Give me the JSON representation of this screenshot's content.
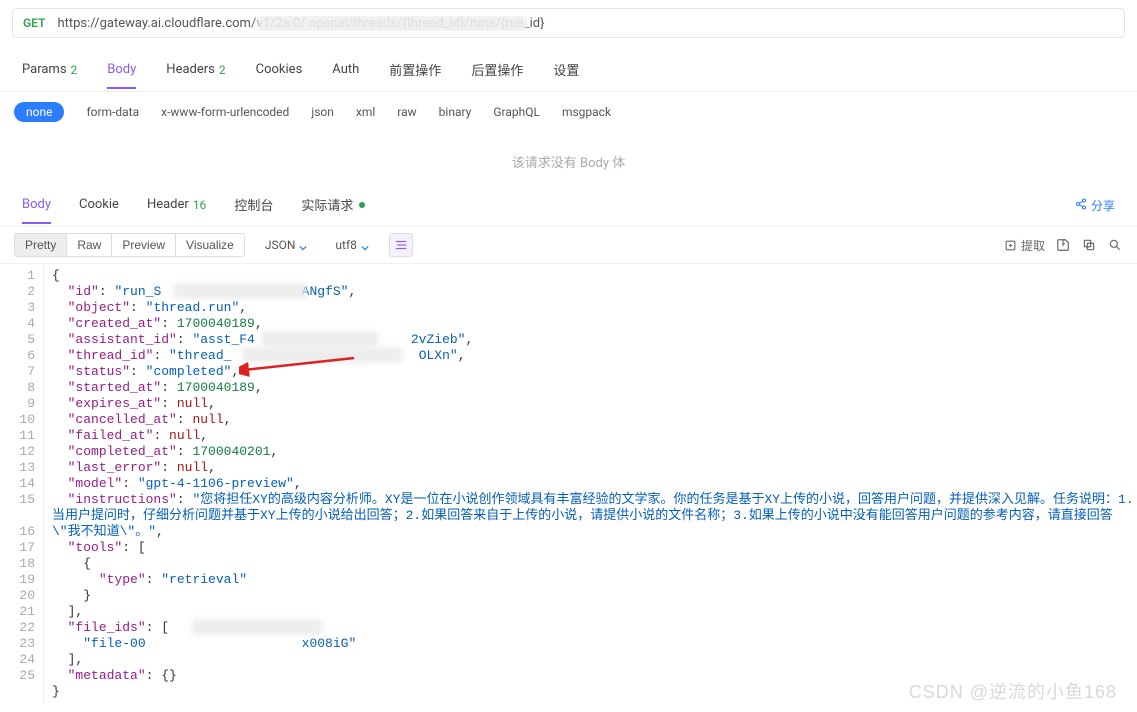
{
  "request": {
    "method": "GET",
    "url": "https://gateway.ai.cloudflare.com/v1/2a                                            0/          openai/threads/{thread_id}/runs/{run_id}"
  },
  "req_tabs": [
    {
      "label": "Params",
      "badge": "2",
      "active": false
    },
    {
      "label": "Body",
      "badge": "",
      "active": true
    },
    {
      "label": "Headers",
      "badge": "2",
      "active": false
    },
    {
      "label": "Cookies",
      "badge": "",
      "active": false
    },
    {
      "label": "Auth",
      "badge": "",
      "active": false
    },
    {
      "label": "前置操作",
      "badge": "",
      "active": false
    },
    {
      "label": "后置操作",
      "badge": "",
      "active": false
    },
    {
      "label": "设置",
      "badge": "",
      "active": false
    }
  ],
  "body_types": {
    "selected": "none",
    "options": [
      "form-data",
      "x-www-form-urlencoded",
      "json",
      "xml",
      "raw",
      "binary",
      "GraphQL",
      "msgpack"
    ]
  },
  "empty_body_text": "该请求没有 Body 体",
  "response_tabs": [
    {
      "label": "Body",
      "badge": "",
      "active": true
    },
    {
      "label": "Cookie",
      "badge": "",
      "active": false
    },
    {
      "label": "Header",
      "badge": "16",
      "active": false
    },
    {
      "label": "控制台",
      "badge": "",
      "active": false
    },
    {
      "label": "实际请求",
      "badge": "",
      "active": false,
      "dot": true
    }
  ],
  "share_label": "分享",
  "view_modes": {
    "options": [
      "Pretty",
      "Raw",
      "Preview",
      "Visualize"
    ],
    "active": "Pretty"
  },
  "format_dropdown": "JSON",
  "encoding_dropdown": "utf8",
  "extract_label": "提取",
  "code_lines": [
    {
      "n": 1,
      "indent": 0,
      "tokens": [
        [
          "p",
          "{"
        ]
      ]
    },
    {
      "n": 2,
      "indent": 1,
      "tokens": [
        [
          "k",
          "\"id\""
        ],
        [
          "p",
          ": "
        ],
        [
          "s",
          "\"run_S                  ANgfS\""
        ],
        [
          "p",
          ","
        ]
      ],
      "blur": [
        130,
        132
      ]
    },
    {
      "n": 3,
      "indent": 1,
      "tokens": [
        [
          "k",
          "\"object\""
        ],
        [
          "p",
          ": "
        ],
        [
          "s",
          "\"thread.run\""
        ],
        [
          "p",
          ","
        ]
      ]
    },
    {
      "n": 4,
      "indent": 1,
      "tokens": [
        [
          "k",
          "\"created_at\""
        ],
        [
          "p",
          ": "
        ],
        [
          "n",
          "1700040189"
        ],
        [
          "p",
          ","
        ]
      ]
    },
    {
      "n": 5,
      "indent": 1,
      "tokens": [
        [
          "k",
          "\"assistant_id\""
        ],
        [
          "p",
          ": "
        ],
        [
          "s",
          "\"asst_F4                    2vZieb\""
        ],
        [
          "p",
          ","
        ]
      ],
      "blur": [
        218,
        116
      ]
    },
    {
      "n": 6,
      "indent": 1,
      "tokens": [
        [
          "k",
          "\"thread_id\""
        ],
        [
          "p",
          ": "
        ],
        [
          "s",
          "\"thread_                        OLXn\""
        ],
        [
          "p",
          ","
        ]
      ],
      "blur": [
        198,
        160
      ]
    },
    {
      "n": 7,
      "indent": 1,
      "tokens": [
        [
          "k",
          "\"status\""
        ],
        [
          "p",
          ": "
        ],
        [
          "s",
          "\"completed\""
        ],
        [
          "p",
          ","
        ]
      ],
      "arrow": true
    },
    {
      "n": 8,
      "indent": 1,
      "tokens": [
        [
          "k",
          "\"started_at\""
        ],
        [
          "p",
          ": "
        ],
        [
          "n",
          "1700040189"
        ],
        [
          "p",
          ","
        ]
      ]
    },
    {
      "n": 9,
      "indent": 1,
      "tokens": [
        [
          "k",
          "\"expires_at\""
        ],
        [
          "p",
          ": "
        ],
        [
          "x",
          "null"
        ],
        [
          "p",
          ","
        ]
      ]
    },
    {
      "n": 10,
      "indent": 1,
      "tokens": [
        [
          "k",
          "\"cancelled_at\""
        ],
        [
          "p",
          ": "
        ],
        [
          "x",
          "null"
        ],
        [
          "p",
          ","
        ]
      ]
    },
    {
      "n": 11,
      "indent": 1,
      "tokens": [
        [
          "k",
          "\"failed_at\""
        ],
        [
          "p",
          ": "
        ],
        [
          "x",
          "null"
        ],
        [
          "p",
          ","
        ]
      ]
    },
    {
      "n": 12,
      "indent": 1,
      "tokens": [
        [
          "k",
          "\"completed_at\""
        ],
        [
          "p",
          ": "
        ],
        [
          "n",
          "1700040201"
        ],
        [
          "p",
          ","
        ]
      ]
    },
    {
      "n": 13,
      "indent": 1,
      "tokens": [
        [
          "k",
          "\"last_error\""
        ],
        [
          "p",
          ": "
        ],
        [
          "x",
          "null"
        ],
        [
          "p",
          ","
        ]
      ]
    },
    {
      "n": 14,
      "indent": 1,
      "tokens": [
        [
          "k",
          "\"model\""
        ],
        [
          "p",
          ": "
        ],
        [
          "s",
          "\"gpt-4-1106-preview\""
        ],
        [
          "p",
          ","
        ]
      ]
    },
    {
      "n": 15,
      "indent": 1,
      "wrap": true,
      "tokens": [
        [
          "k",
          "\"instructions\""
        ],
        [
          "p",
          ": "
        ],
        [
          "s",
          "\"您将担任XY的高级内容分析师。XY是一位在小说创作领域具有丰富经验的文学家。你的任务是基于XY上传的小说，回答用户问题，并提供深入见解。任务说明：1.当用户提问时，仔细分析问题并基于XY上传的小说给出回答；2.如果回答来自于上传的小说，请提供小说的文件名称；3.如果上传的小说中没有能回答用户问题的参考内容，请直接回答\\\"我不知道\\\"。\""
        ],
        [
          "p",
          ","
        ]
      ]
    },
    {
      "n": 16,
      "indent": 1,
      "tokens": [
        [
          "k",
          "\"tools\""
        ],
        [
          "p",
          ": ["
        ]
      ]
    },
    {
      "n": 17,
      "indent": 2,
      "tokens": [
        [
          "p",
          "{"
        ]
      ]
    },
    {
      "n": 18,
      "indent": 3,
      "tokens": [
        [
          "k",
          "\"type\""
        ],
        [
          "p",
          ": "
        ],
        [
          "s",
          "\"retrieval\""
        ]
      ]
    },
    {
      "n": 19,
      "indent": 2,
      "tokens": [
        [
          "p",
          "}"
        ]
      ]
    },
    {
      "n": 20,
      "indent": 1,
      "tokens": [
        [
          "p",
          "],"
        ]
      ]
    },
    {
      "n": 21,
      "indent": 1,
      "tokens": [
        [
          "k",
          "\"file_ids\""
        ],
        [
          "p",
          ": ["
        ]
      ]
    },
    {
      "n": 22,
      "indent": 2,
      "tokens": [
        [
          "s",
          "\"file-00                    x008iG\""
        ]
      ],
      "blur": [
        148,
        130
      ]
    },
    {
      "n": 23,
      "indent": 1,
      "tokens": [
        [
          "p",
          "],"
        ]
      ]
    },
    {
      "n": 24,
      "indent": 1,
      "tokens": [
        [
          "k",
          "\"metadata\""
        ],
        [
          "p",
          ": {}"
        ]
      ]
    },
    {
      "n": 25,
      "indent": 0,
      "tokens": [
        [
          "p",
          "}"
        ]
      ]
    }
  ],
  "watermark": "CSDN @逆流的小鱼168"
}
